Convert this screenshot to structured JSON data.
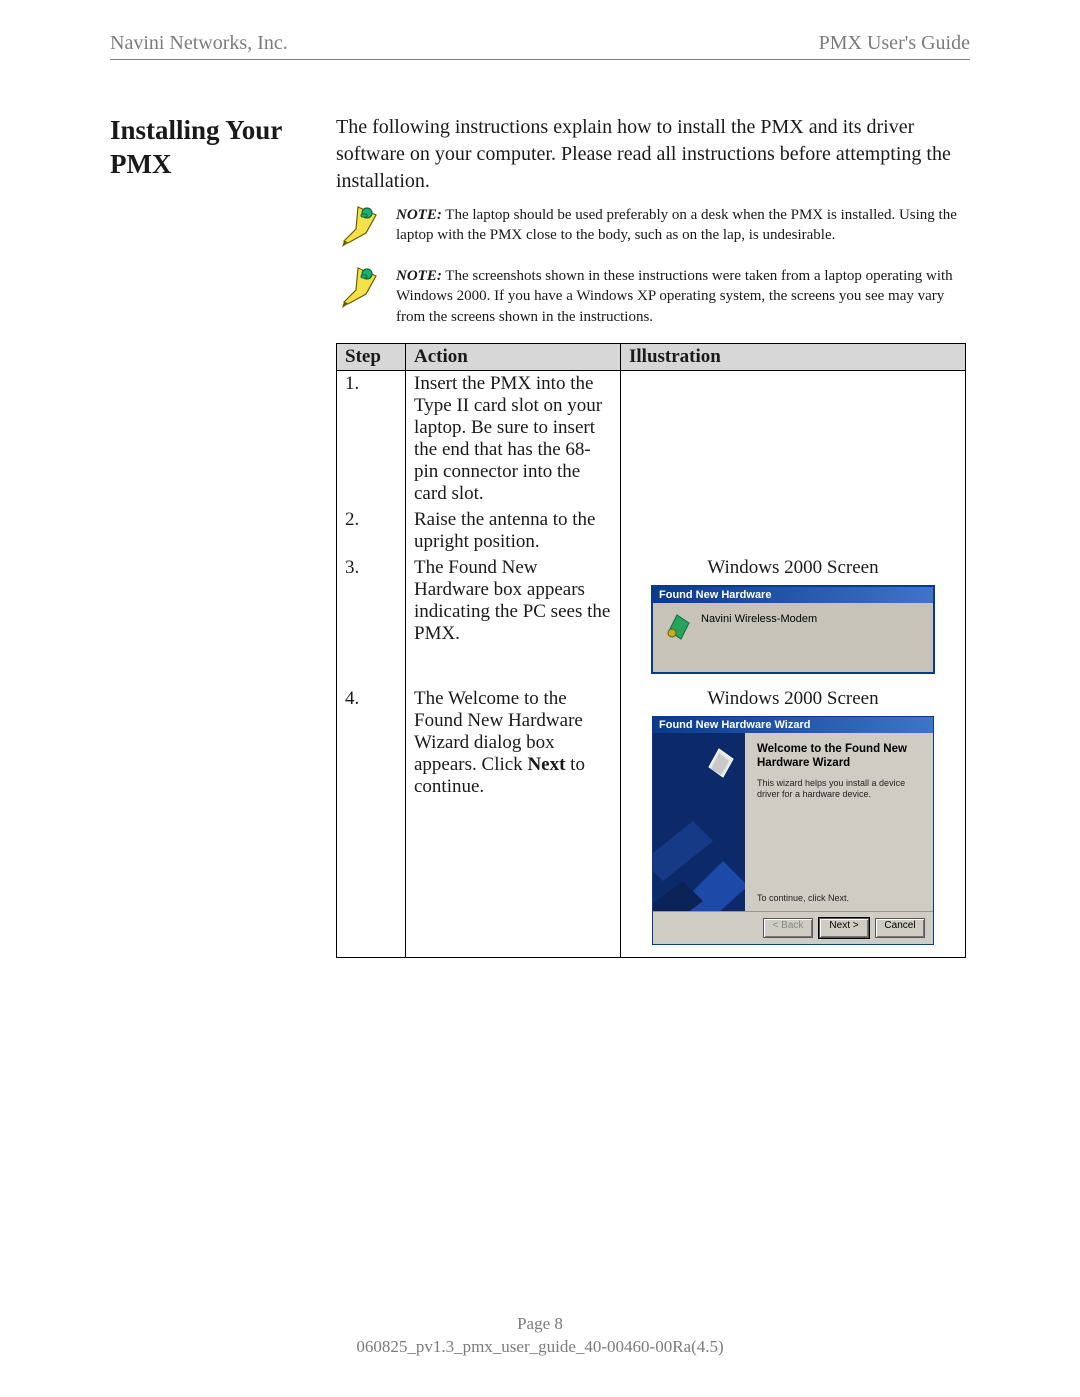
{
  "header": {
    "left": "Navini Networks, Inc.",
    "right": "PMX User's Guide"
  },
  "section_title": "Installing Your PMX",
  "intro": "The following instructions explain how to install the PMX and its driver software on your computer. Please read all instructions before attempting the installation.",
  "notes": [
    {
      "label": "NOTE:",
      "text": "  The laptop should be used preferably on a desk when the PMX is installed. Using the laptop with the PMX close to the body, such as on the lap, is undesirable."
    },
    {
      "label": "NOTE:",
      "text": " The screenshots shown in these instructions were taken from a laptop operating with Windows 2000. If you have a Windows XP operating system, the screens you see may vary from the screens shown in the instructions."
    }
  ],
  "table": {
    "headers": {
      "step": "Step",
      "action": "Action",
      "illustration": "Illustration"
    },
    "rows": [
      {
        "step": "1.",
        "action": "Insert the PMX into the Type II card slot on your laptop. Be sure to insert the end that has the 68-pin connector into the card slot."
      },
      {
        "step": "2.",
        "action": "Raise the antenna to the upright position."
      },
      {
        "step": "3.",
        "action": "The Found New Hardware box appears indicating the PC sees the PMX.",
        "caption": "Windows 2000 Screen",
        "fnh": {
          "title": "Found New Hardware",
          "body": "Navini Wireless-Modem"
        }
      },
      {
        "step": "4.",
        "action_parts": [
          "The Welcome to the Found New Hardware Wizard dialog box appears. Click ",
          "Next",
          " to continue."
        ],
        "caption": "Windows 2000 Screen",
        "wizard": {
          "title": "Found New Hardware Wizard",
          "heading": "Welcome to the Found New Hardware Wizard",
          "sub": "This wizard helps you install a device driver for a hardware device.",
          "cont": "To continue, click Next.",
          "buttons": {
            "back": "< Back",
            "next": "Next >",
            "cancel": "Cancel"
          }
        }
      }
    ]
  },
  "footer": {
    "page": "Page 8",
    "docid": "060825_pv1.3_pmx_user_guide_40-00460-00Ra(4.5)"
  }
}
